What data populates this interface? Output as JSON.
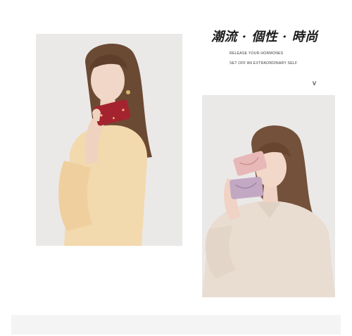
{
  "headline": "潮流 · 個性 · 時尚",
  "taglines": [
    "RELEASE YOUR HORMONES",
    "SET OFF AN EXTRAORDINARY SELF"
  ],
  "chevron_glyph": "v",
  "colors": {
    "background": "#ffffff",
    "photo_backdrop": "#ebe9e8",
    "wallet_red": "#a5232f",
    "wallet_pink": "#e7b8b7",
    "wallet_lilac": "#c3a8c4",
    "dress_yellow": "#f3d9ae",
    "blouse_cream": "#e9ddd2",
    "hair_brown": "#6b4a33"
  }
}
